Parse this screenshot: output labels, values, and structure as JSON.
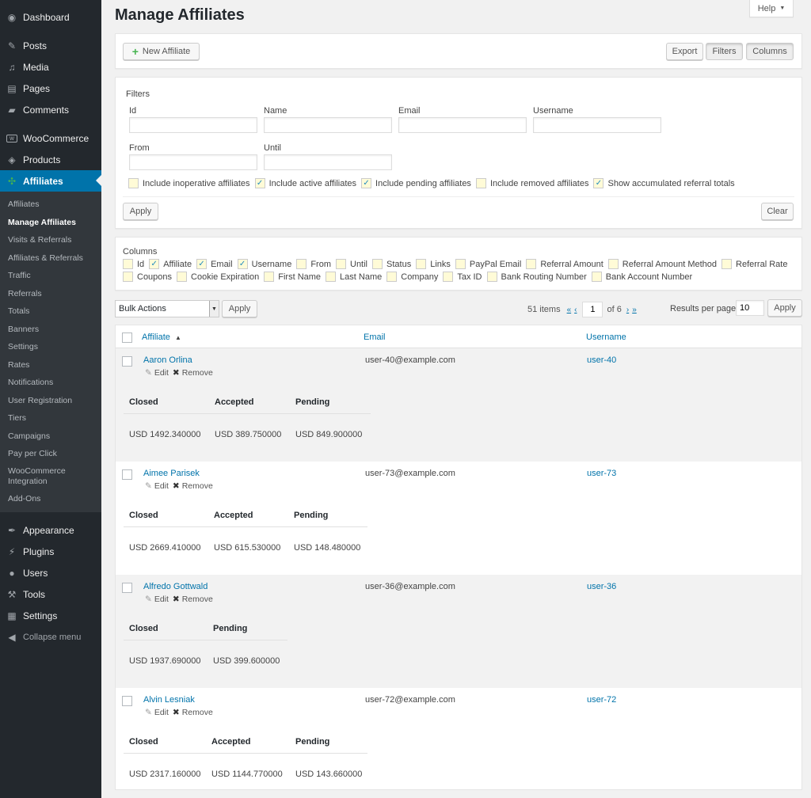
{
  "sidebar": {
    "top_items": [
      {
        "label": "Dashboard",
        "icon": "dashboard-icon"
      },
      {
        "label": "Posts",
        "icon": "pin-icon"
      },
      {
        "label": "Media",
        "icon": "media-icon"
      },
      {
        "label": "Pages",
        "icon": "pages-icon"
      },
      {
        "label": "Comments",
        "icon": "comment-icon"
      },
      {
        "label": "WooCommerce",
        "icon": "woo-icon"
      },
      {
        "label": "Products",
        "icon": "box-icon"
      },
      {
        "label": "Affiliates",
        "icon": "affiliates-icon"
      }
    ],
    "sub_items": [
      "Affiliates",
      "Manage Affiliates",
      "Visits & Referrals",
      "Affiliates & Referrals",
      "Traffic",
      "Referrals",
      "Totals",
      "Banners",
      "Settings",
      "Rates",
      "Notifications",
      "User Registration",
      "Tiers",
      "Campaigns",
      "Pay per Click",
      "WooCommerce Integration",
      "Add-Ons"
    ],
    "bottom_items": [
      {
        "label": "Appearance",
        "icon": "brush-icon"
      },
      {
        "label": "Plugins",
        "icon": "plug-icon"
      },
      {
        "label": "Users",
        "icon": "user-icon"
      },
      {
        "label": "Tools",
        "icon": "wrench-icon"
      },
      {
        "label": "Settings",
        "icon": "settings-icon"
      }
    ],
    "collapse_label": "Collapse menu",
    "accent_color": "#0073aa"
  },
  "header": {
    "title": "Manage Affiliates",
    "help_label": "Help"
  },
  "toolbar": {
    "new_affiliate": "New Affiliate",
    "export": "Export",
    "filters": "Filters",
    "columns": "Columns"
  },
  "filters": {
    "heading": "Filters",
    "labels": {
      "id": "Id",
      "name": "Name",
      "email": "Email",
      "username": "Username",
      "from": "From",
      "until": "Until"
    },
    "values": {
      "id": "",
      "name": "",
      "email": "",
      "username": "",
      "from": "",
      "until": ""
    },
    "checkboxes": [
      {
        "label": "Include inoperative affiliates",
        "checked": false
      },
      {
        "label": "Include active affiliates",
        "checked": true
      },
      {
        "label": "Include pending affiliates",
        "checked": true
      },
      {
        "label": "Include removed affiliates",
        "checked": false
      },
      {
        "label": "Show accumulated referral totals",
        "checked": true
      }
    ],
    "apply": "Apply",
    "clear": "Clear"
  },
  "columns": {
    "heading": "Columns",
    "row1": [
      {
        "label": "Id",
        "checked": false
      },
      {
        "label": "Affiliate",
        "checked": true
      },
      {
        "label": "Email",
        "checked": true
      },
      {
        "label": "Username",
        "checked": true
      },
      {
        "label": "From",
        "checked": false
      },
      {
        "label": "Until",
        "checked": false
      },
      {
        "label": "Status",
        "checked": false
      },
      {
        "label": "Links",
        "checked": false
      },
      {
        "label": "PayPal Email",
        "checked": false
      },
      {
        "label": "Referral Amount",
        "checked": false
      },
      {
        "label": "Referral Amount Method",
        "checked": false
      },
      {
        "label": "Referral Rate",
        "checked": false
      }
    ],
    "row2": [
      {
        "label": "Coupons",
        "checked": false
      },
      {
        "label": "Cookie Expiration",
        "checked": false
      },
      {
        "label": "First Name",
        "checked": false
      },
      {
        "label": "Last Name",
        "checked": false
      },
      {
        "label": "Company",
        "checked": false
      },
      {
        "label": "Tax ID",
        "checked": false
      },
      {
        "label": "Bank Routing Number",
        "checked": false
      },
      {
        "label": "Bank Account Number",
        "checked": false
      }
    ]
  },
  "tablenav": {
    "bulk_actions": "Bulk Actions",
    "apply": "Apply",
    "items": "51 items",
    "first": "«",
    "prev": "‹",
    "current_page": "1",
    "of_pages": "of 6",
    "next": "›",
    "last": "»",
    "results_label": "Results per page",
    "results_value": "10",
    "results_apply": "Apply"
  },
  "table": {
    "headers": {
      "affiliate": "Affiliate",
      "sort_indicator": "▲",
      "email": "Email",
      "username": "Username"
    },
    "edit": "Edit",
    "remove": "Remove",
    "rows": [
      {
        "name": "Aaron Orlina",
        "email": "user-40@example.com",
        "username": "user-40",
        "totals": [
          {
            "label": "Closed",
            "value": "USD 1492.340000"
          },
          {
            "label": "Accepted",
            "value": "USD 389.750000"
          },
          {
            "label": "Pending",
            "value": "USD 849.900000"
          }
        ]
      },
      {
        "name": "Aimee Parisek",
        "email": "user-73@example.com",
        "username": "user-73",
        "totals": [
          {
            "label": "Closed",
            "value": "USD 2669.410000"
          },
          {
            "label": "Accepted",
            "value": "USD 615.530000"
          },
          {
            "label": "Pending",
            "value": "USD 148.480000"
          }
        ]
      },
      {
        "name": "Alfredo Gottwald",
        "email": "user-36@example.com",
        "username": "user-36",
        "totals": [
          {
            "label": "Closed",
            "value": "USD 1937.690000"
          },
          {
            "label": "Pending",
            "value": "USD 399.600000"
          }
        ]
      },
      {
        "name": "Alvin Lesniak",
        "email": "user-72@example.com",
        "username": "user-72",
        "totals": [
          {
            "label": "Closed",
            "value": "USD 2317.160000"
          },
          {
            "label": "Accepted",
            "value": "USD 1144.770000"
          },
          {
            "label": "Pending",
            "value": "USD 143.660000"
          }
        ]
      }
    ]
  }
}
